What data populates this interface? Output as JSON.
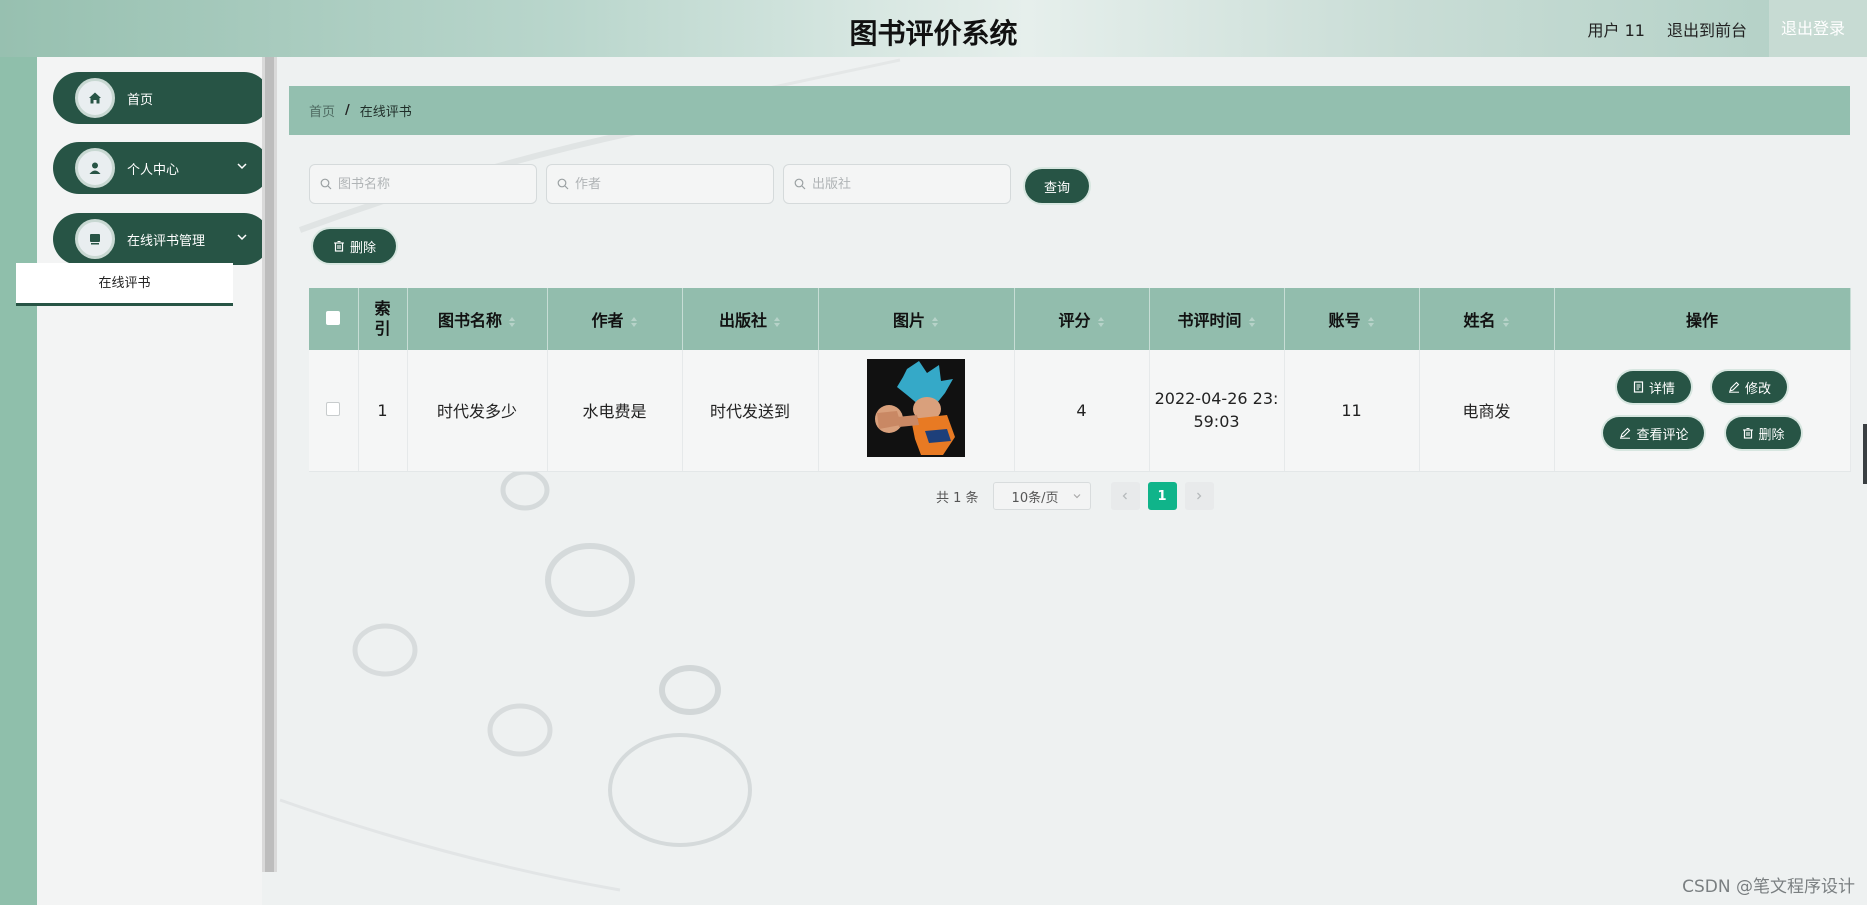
{
  "header": {
    "title": "图书评价系统",
    "user": "用户 11",
    "back_to_front": "退出到前台",
    "logout": "退出登录"
  },
  "sidebar": {
    "items": [
      {
        "label": "首页",
        "icon": "home-icon"
      },
      {
        "label": "个人中心",
        "icon": "user-icon"
      },
      {
        "label": "在线评书管理",
        "icon": "book-icon"
      }
    ],
    "submenu_item": "在线评书"
  },
  "breadcrumb": {
    "home": "首页",
    "separator": "/",
    "current": "在线评书"
  },
  "search": {
    "book_name_placeholder": "图书名称",
    "author_placeholder": "作者",
    "publisher_placeholder": "出版社",
    "query_button": "查询"
  },
  "toolbar": {
    "delete_button": "删除"
  },
  "table": {
    "headers": {
      "index": "索引",
      "book_name": "图书名称",
      "author": "作者",
      "publisher": "出版社",
      "image": "图片",
      "rating": "评分",
      "review_time": "书评时间",
      "account": "账号",
      "name": "姓名",
      "actions": "操作"
    },
    "rows": [
      {
        "index": "1",
        "book_name": "时代发多少",
        "author": "水电费是",
        "publisher": "时代发送到",
        "rating": "4",
        "review_time_line1": "2022-04-26 23:",
        "review_time_line2": "59:03",
        "account": "11",
        "name": "电商发"
      }
    ],
    "row_buttons": {
      "detail": "详情",
      "edit": "修改",
      "view_comments": "查看评论",
      "delete": "删除"
    }
  },
  "pagination": {
    "total": "共 1 条",
    "page_size": "10条/页",
    "current_page": "1"
  },
  "watermark": "CSDN @笔文程序设计",
  "colors": {
    "primary": "#275445",
    "header_green": "#92bdad",
    "page_active": "#10b48a"
  }
}
